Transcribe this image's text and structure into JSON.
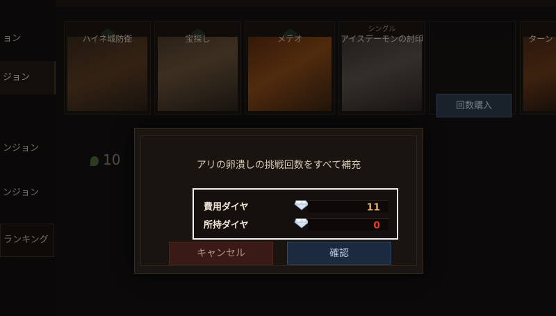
{
  "sidebar": {
    "items": [
      {
        "label": "ョン"
      },
      {
        "label": "ジョン"
      },
      {
        "label": "ンジョン"
      },
      {
        "label": "ンジョン"
      },
      {
        "label": "ランキング"
      }
    ]
  },
  "cards": [
    {
      "title": "ハイネ城防衛",
      "sub": ""
    },
    {
      "title": "宝探し",
      "sub": ""
    },
    {
      "title": "メテオ",
      "sub": ""
    },
    {
      "title": "アイスデーモンの討印",
      "sub": "シングル"
    },
    {
      "title": "",
      "sub": ""
    },
    {
      "title": "ターン",
      "sub": ""
    }
  ],
  "background": {
    "buy_button": "回数購入",
    "remaining_count": "10"
  },
  "dialog": {
    "message": "アリの卵潰しの挑戦回数をすべて補充",
    "cost_label": "費用ダイヤ",
    "cost_value": "11",
    "owned_label": "所持ダイヤ",
    "owned_value": "0",
    "cancel_label": "キャンセル",
    "confirm_label": "確認"
  },
  "colors": {
    "cost_value": "#e8a85a",
    "owned_value": "#e23a2a",
    "highlight_border": "#f2f2f2"
  }
}
